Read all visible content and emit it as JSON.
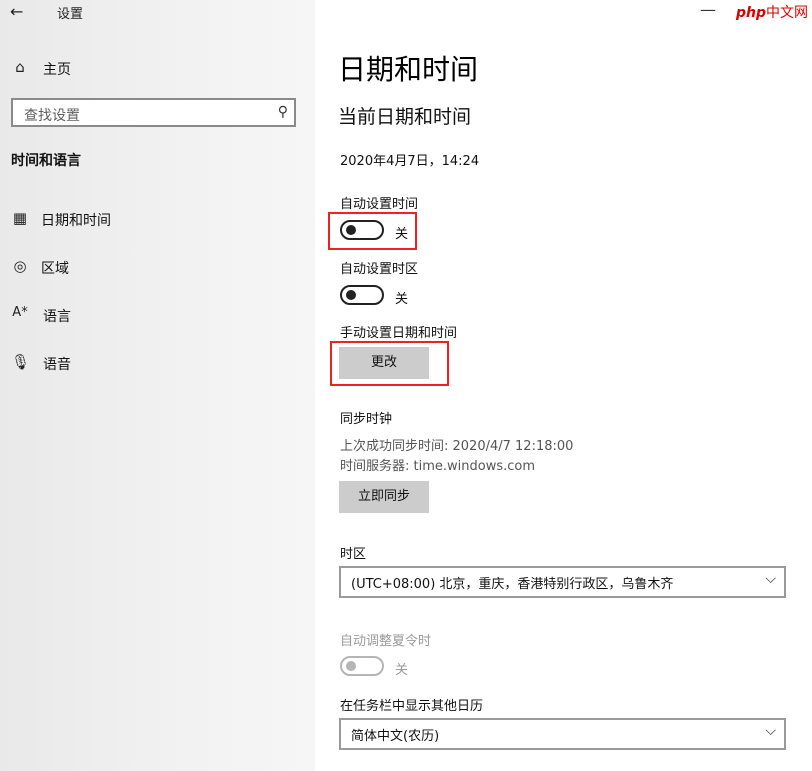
{
  "window": {
    "back_glyph": "←",
    "title": "设置",
    "minimize_glyph": "—"
  },
  "branding": {
    "logo_php": "php",
    "logo_cn": "中文网"
  },
  "sidebar": {
    "home_label": "主页",
    "search_placeholder": "查找设置",
    "section": "时间和语言",
    "items": [
      {
        "label": "日期和时间",
        "icon": "calendar-icon"
      },
      {
        "label": "区域",
        "icon": "globe-icon"
      },
      {
        "label": "语言",
        "icon": "language-icon"
      },
      {
        "label": "语音",
        "icon": "microphone-icon"
      }
    ]
  },
  "main": {
    "title": "日期和时间",
    "subtitle": "当前日期和时间",
    "current_datetime": "2020年4月7日，14:24",
    "auto_time": {
      "label": "自动设置时间",
      "state": "关"
    },
    "auto_timezone": {
      "label": "自动设置时区",
      "state": "关"
    },
    "manual": {
      "label": "手动设置日期和时间",
      "button": "更改"
    },
    "sync": {
      "label": "同步时钟",
      "last_sync": "上次成功同步时间: 2020/4/7 12:18:00",
      "server": "时间服务器: time.windows.com",
      "button": "立即同步"
    },
    "timezone": {
      "label": "时区",
      "value": "(UTC+08:00) 北京，重庆，香港特别行政区，乌鲁木齐"
    },
    "dst": {
      "label": "自动调整夏令时",
      "state": "关"
    },
    "calendar": {
      "label": "在任务栏中显示其他日历",
      "value": "简体中文(农历)"
    }
  },
  "colors": {
    "highlight": "#e22222",
    "button_bg": "#cccccc",
    "sidebar_bg": "#f2f2f2"
  }
}
